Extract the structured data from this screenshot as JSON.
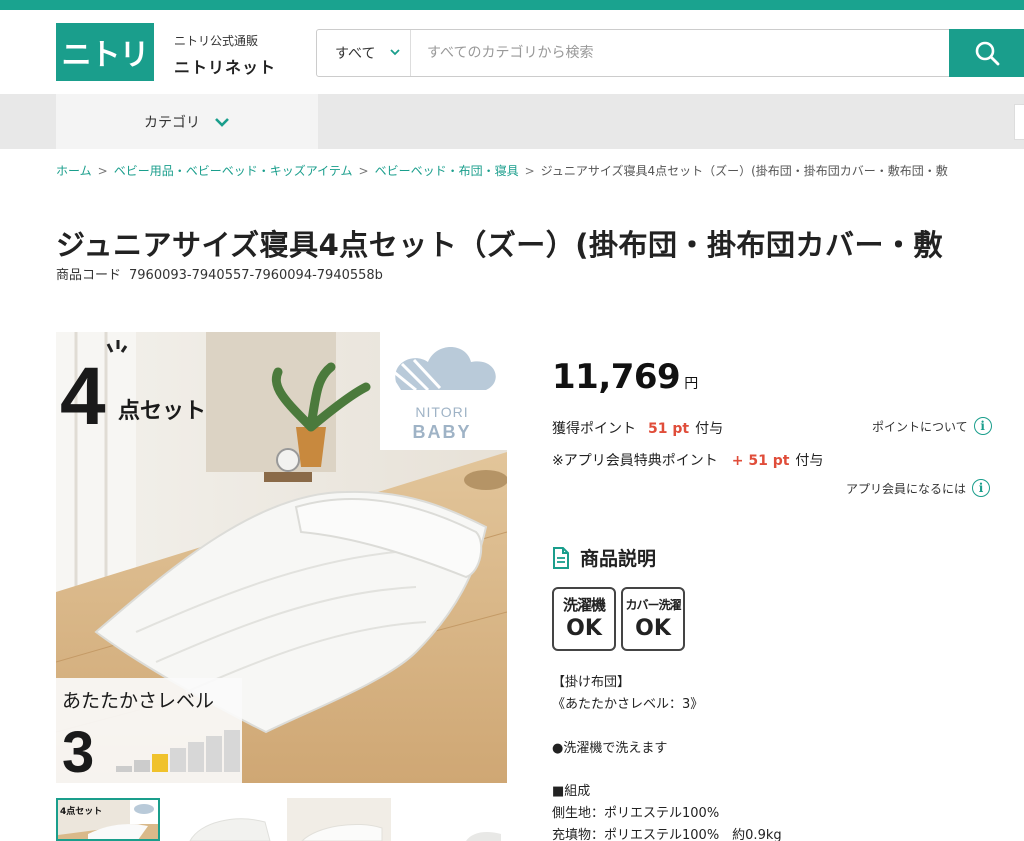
{
  "header": {
    "logo": "ニトリ",
    "site_subtitle": "ニトリ公式通販",
    "site_name": "ニトリネット",
    "search_category": "すべて",
    "search_placeholder": "すべてのカテゴリから検索"
  },
  "nav": {
    "category_label": "カテゴリ"
  },
  "breadcrumb": {
    "items": [
      "ホーム",
      "ベビー用品・ベビーベッド・キッズアイテム",
      "ベビーベッド・布団・寝具"
    ],
    "current": "ジュニアサイズ寝具4点セット（ズー）(掛布団・掛布団カバー・敷布団・敷"
  },
  "product": {
    "title": "ジュニアサイズ寝具4点セット（ズー）(掛布団・掛布団カバー・敷",
    "code_label": "商品コード",
    "code_value": "7960093-7940557-7960094-7940558b",
    "price": "11,769",
    "yen": "円",
    "points_label": "獲得ポイント",
    "points_value": "51 pt",
    "points_suffix": "付与",
    "points_about": "ポイントについて",
    "app_points_label": "※アプリ会員特典ポイント",
    "app_points_value": "+ 51 pt",
    "app_points_suffix": "付与",
    "app_member_link": "アプリ会員になるには",
    "info_glyph": "i"
  },
  "image": {
    "set_count": "4",
    "set_label": "点セット",
    "brand_line1": "NITORI",
    "brand_line2": "BABY",
    "warmth_label": "あたたかさレベル",
    "warmth_value": "3",
    "thumb_set_label": "4点セット"
  },
  "description": {
    "heading": "商品説明",
    "badges": [
      {
        "top": "洗濯機",
        "bottom": "OK"
      },
      {
        "top": "カバー洗濯",
        "bottom": "OK"
      }
    ],
    "lines": [
      "【掛け布団】",
      "《あたたかさレベル：3》",
      "",
      "●洗濯機で洗えます",
      "",
      "■組成",
      "側生地：ポリエステル100%",
      "充填物：ポリエステル100%　約0.9kg"
    ]
  },
  "colors": {
    "brand": "#1a9e8c",
    "point_red": "#e04d3a"
  }
}
